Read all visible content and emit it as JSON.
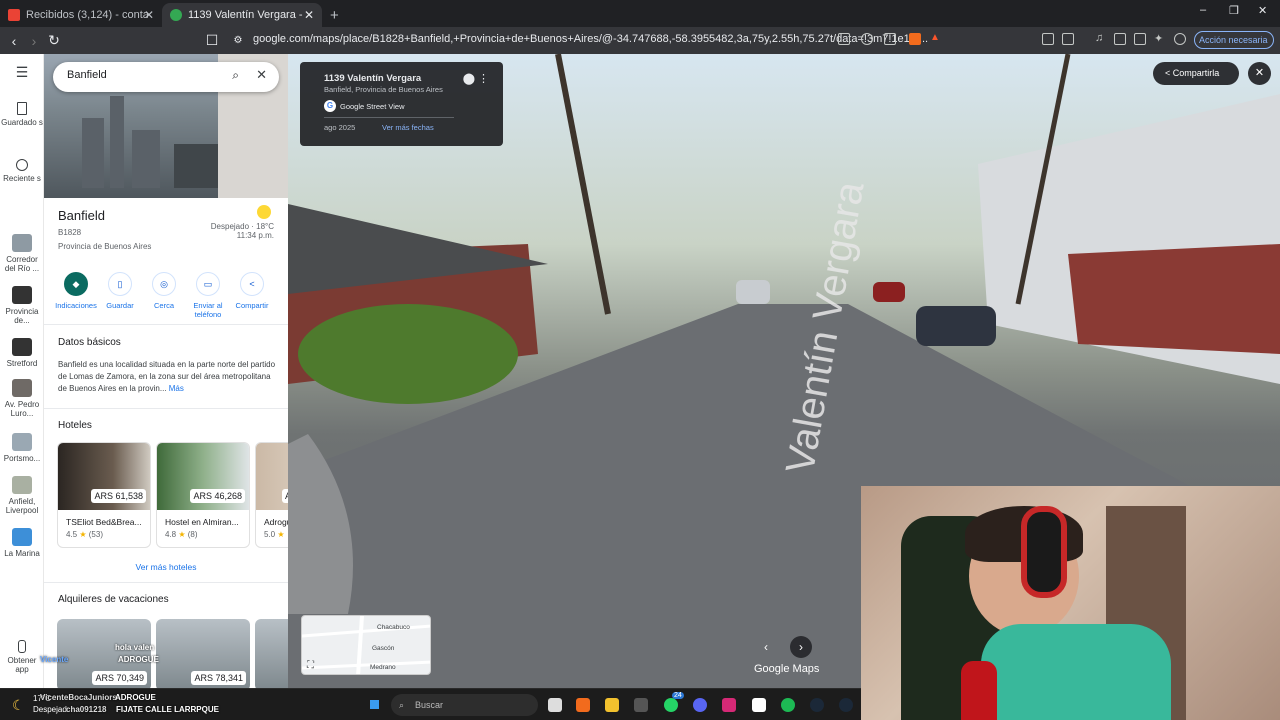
{
  "browser": {
    "tabs": [
      {
        "title": "Recibidos (3,124) - contactomelogra...",
        "active": false
      },
      {
        "title": "1139 Valentín Vergara - Google ...",
        "active": true
      }
    ],
    "new_tab": "+",
    "url": "google.com/maps/place/B1828+Banfield,+Provincia+de+Buenos+Aires/@-34.747688,-58.3955482,3a,75y,2.55h,75.27t/data=!3m7!1e1!3...",
    "accion": "Acción necesaria",
    "window_controls": [
      "–",
      "❐",
      "✕"
    ]
  },
  "rail": {
    "items": [
      {
        "label": "Guardado s",
        "icon": "bookmark-icon"
      },
      {
        "label": "Reciente s",
        "icon": "history-icon"
      },
      {
        "label": "Corredor del Río ...",
        "icon": "place-thumb"
      },
      {
        "label": "Provincia de...",
        "icon": "place-thumb"
      },
      {
        "label": "Stretford",
        "icon": "place-thumb"
      },
      {
        "label": "Av. Pedro Luro...",
        "icon": "place-thumb"
      },
      {
        "label": "Portsmo...",
        "icon": "place-thumb"
      },
      {
        "label": "Anfield, Liverpool",
        "icon": "place-thumb"
      },
      {
        "label": "La Marina",
        "icon": "place-thumb"
      },
      {
        "label": "Obtener app",
        "icon": "phone-icon"
      }
    ]
  },
  "panel": {
    "search_value": "Banfield",
    "place_name": "Banfield",
    "postal": "B1828",
    "province": "Provincia de Buenos Aires",
    "weather": "Despejado · 18°C",
    "time": "11:34 p.m.",
    "actions": [
      {
        "label": "Indicaciones",
        "icon": "directions-icon"
      },
      {
        "label": "Guardar",
        "icon": "bookmark-icon"
      },
      {
        "label": "Cerca",
        "icon": "nearby-icon"
      },
      {
        "label": "Enviar al teléfono",
        "icon": "send-phone-icon"
      },
      {
        "label": "Compartir",
        "icon": "share-icon"
      }
    ],
    "datos_title": "Datos básicos",
    "description": "Banfield es una localidad situada en la parte norte del partido de Lomas de Zamora, en la zona sur del área metropolitana de Buenos Aires en la provin...",
    "more": "Más",
    "hotels_title": "Hoteles",
    "hotels": [
      {
        "price": "ARS 61,538",
        "name": "TSEliot Bed&Brea...",
        "rating": "4.5",
        "reviews": "(53)"
      },
      {
        "price": "ARS 46,268",
        "name": "Hostel en Almiran...",
        "rating": "4.8",
        "reviews": "(8)"
      },
      {
        "price": "A",
        "name": "Adrogu",
        "rating": "5.0",
        "reviews": ""
      }
    ],
    "ver_mas_hoteles": "Ver más hoteles",
    "alquileres_title": "Alquileres de vacaciones",
    "rentals": [
      {
        "price": "ARS 70,349"
      },
      {
        "price": "ARS 78,341"
      }
    ]
  },
  "streetview": {
    "address": "1139 Valentín Vergara",
    "locality": "Banfield, Provincia de Buenos Aires",
    "source": "Google Street View",
    "date": "ago 2025",
    "more_dates": "Ver más fechas",
    "share": "Compartirla",
    "street_label": "Valentín Vergara",
    "brand": "Google Maps",
    "minimap_labels": [
      "Chacabuco",
      "Gascón",
      "Medrano"
    ]
  },
  "taskbar": {
    "weather_temp": "17°C",
    "weather_desc": "Despejad",
    "search_placeholder": "Buscar",
    "badge": "24"
  },
  "chat": {
    "lines": [
      {
        "user": "",
        "text": "hola valen"
      },
      {
        "user": "Vicente",
        "text": "ADROGUE"
      },
      {
        "user": "VicenteBocaJuniors",
        "text": "ADROGUE"
      },
      {
        "user": "cha091218",
        "text": "FIJATE CALLE LARRPQUE"
      }
    ]
  }
}
